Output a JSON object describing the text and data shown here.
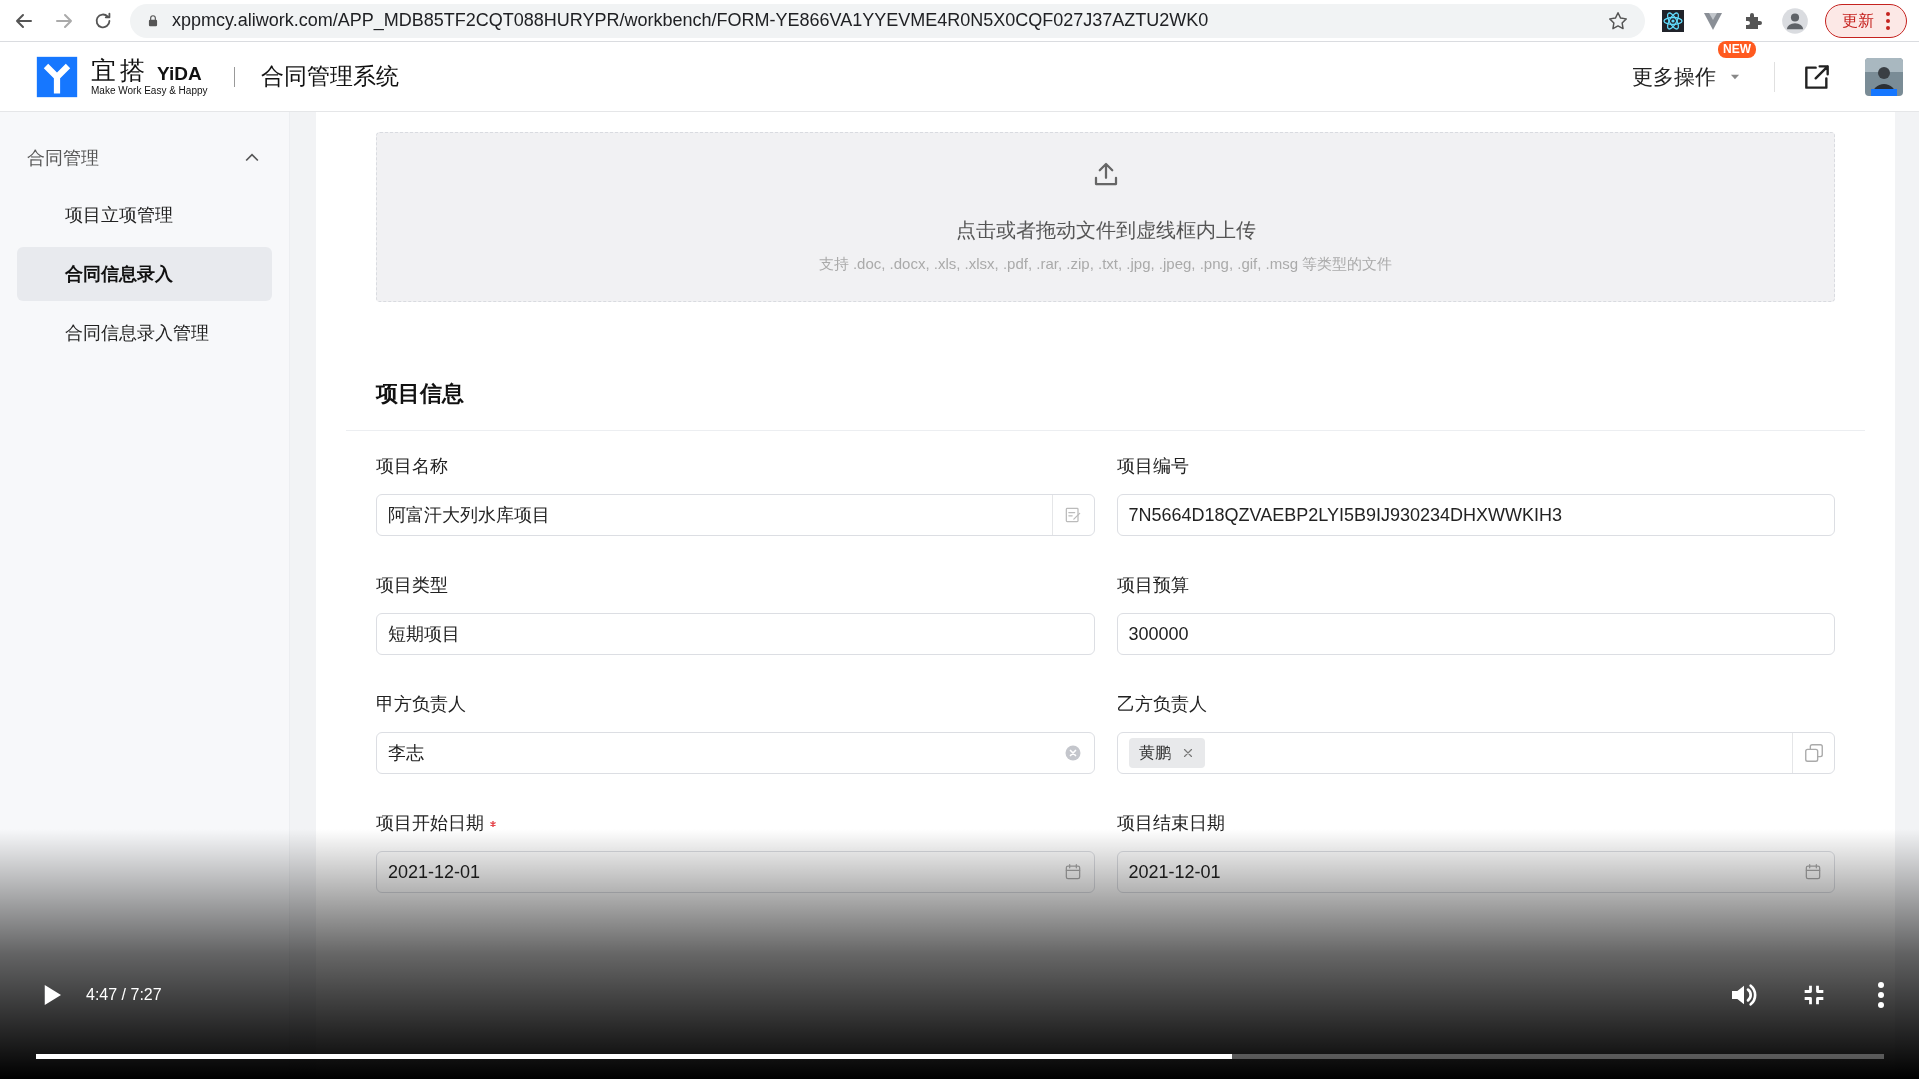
{
  "browser": {
    "url": "xppmcy.aliwork.com/APP_MDB85TF2CQT088HURYPR/workbench/FORM-YE866VA1YYEVME4R0N5X0CQF027J37AZTU2WK0",
    "update_button": "更新"
  },
  "header": {
    "logo_cn": "宜搭",
    "logo_en": "YiDA",
    "slogan": "Make Work Easy & Happy",
    "app_title": "合同管理系统",
    "more_actions": "更多操作",
    "badge": "NEW"
  },
  "sidebar": {
    "group": {
      "label": "合同管理",
      "expanded": true,
      "children": [
        {
          "label": "项目立项管理",
          "selected": false
        },
        {
          "label": "合同信息录入",
          "selected": true
        },
        {
          "label": "合同信息录入管理",
          "selected": false
        }
      ]
    }
  },
  "upload": {
    "title": "点击或者拖动文件到虚线框内上传",
    "hint": "支持 .doc, .docx, .xls, .xlsx, .pdf, .rar, .zip, .txt, .jpg, .jpeg, .png, .gif, .msg 等类型的文件"
  },
  "section": {
    "title": "项目信息",
    "fields": [
      {
        "label": "项目名称",
        "required": false,
        "kind": "edit",
        "value": "阿富汗大列水库项目"
      },
      {
        "label": "项目编号",
        "required": false,
        "kind": "plain",
        "value": "7N5664D18QZVAEBP2LYI5B9IJ930234DHXWWKIH3"
      },
      {
        "label": "项目类型",
        "required": false,
        "kind": "plain",
        "value": "短期项目"
      },
      {
        "label": "项目预算",
        "required": false,
        "kind": "plain",
        "value": "300000"
      },
      {
        "label": "甲方负责人",
        "required": false,
        "kind": "clearable",
        "value": "李志"
      },
      {
        "label": "乙方负责人",
        "required": false,
        "kind": "tags",
        "tags": [
          "黄鹏"
        ]
      },
      {
        "label": "项目开始日期",
        "required": true,
        "kind": "date",
        "value": "2021-12-01"
      },
      {
        "label": "项目结束日期",
        "required": false,
        "kind": "date",
        "value": "2021-12-01"
      }
    ]
  },
  "video": {
    "time": "4:47 / 7:27",
    "level": 0.647
  }
}
